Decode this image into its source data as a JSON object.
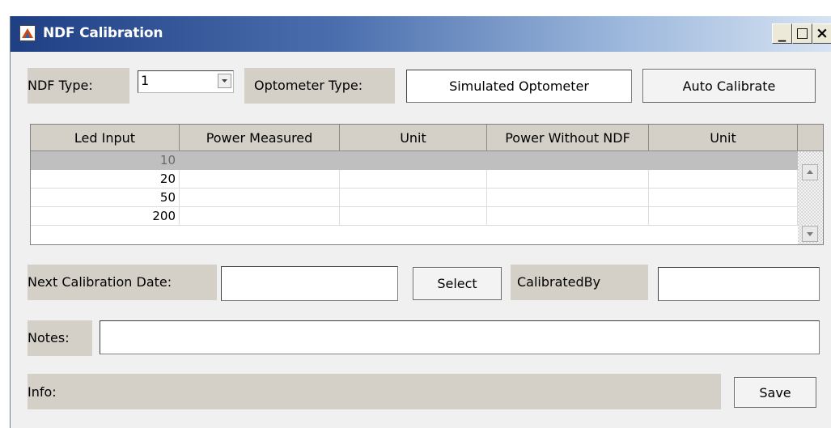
{
  "window": {
    "title": "NDF Calibration",
    "controls": {
      "minimize": "_",
      "maximize": "□",
      "close": "×"
    }
  },
  "top_row": {
    "ndf_type_label": "NDF Type:",
    "ndf_type_value": "1",
    "optometer_type_label": "Optometer Type:",
    "optometer_type_value": "Simulated Optometer",
    "auto_calibrate_label": "Auto Calibrate"
  },
  "table": {
    "headers": [
      "Led Input",
      "Power Measured",
      "Unit",
      "Power Without NDF",
      "Unit"
    ],
    "rows": [
      {
        "cells": [
          "10",
          "",
          "",
          "",
          ""
        ],
        "selected": true
      },
      {
        "cells": [
          "20",
          "",
          "",
          "",
          ""
        ],
        "selected": false
      },
      {
        "cells": [
          "50",
          "",
          "",
          "",
          ""
        ],
        "selected": false
      },
      {
        "cells": [
          "200",
          "",
          "",
          "",
          ""
        ],
        "selected": false
      }
    ]
  },
  "calibration_row": {
    "next_date_label": "Next Calibration Date:",
    "next_date_value": "",
    "select_label": "Select",
    "calibrated_by_label": "CalibratedBy",
    "calibrated_by_value": ""
  },
  "notes": {
    "label": "Notes:",
    "value": ""
  },
  "footer": {
    "info_label": "Info:",
    "save_label": "Save"
  },
  "colors": {
    "selected_row": "#bfbfbf",
    "panel": "#d4d0c8",
    "title_gradient_start": "#1f3f84"
  }
}
